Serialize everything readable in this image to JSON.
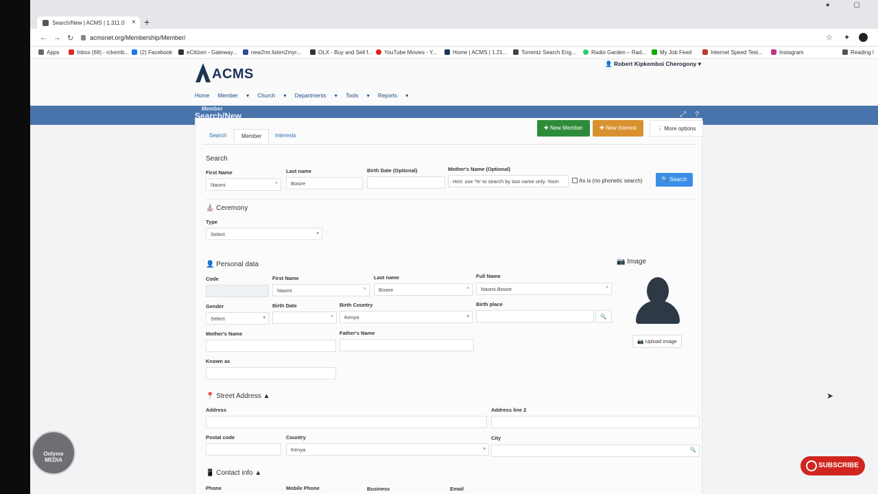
{
  "browser": {
    "tab_title": "Search/New | ACMS | 1.311.0",
    "url": "acmsnet.org/Membership/Member/",
    "bookmarks": [
      "Apps",
      "Inbox (69) - rckemb...",
      "(2) Facebook",
      "eCitizen - Gateway...",
      "new2mr.listen2myr...",
      "OLX - Buy and Sell f...",
      "YouTube Movies - Y...",
      "Home | ACMS | 1.21...",
      "Torrentz Search Eng...",
      "Radio Garden – Rad...",
      "My Job Feed",
      "Internet Speed Test...",
      "Instagram",
      "Reading l"
    ]
  },
  "app": {
    "logo": "ACMS",
    "user": "Robert Kipkemboi Cherogony",
    "menu": [
      "Home",
      "Member",
      "Church",
      "Departments",
      "Tools",
      "Reports"
    ],
    "breadcrumb_pre": "Member",
    "page_title": "Search/New"
  },
  "tabs": [
    "Search",
    "Member",
    "Interests"
  ],
  "actions": {
    "new_member": "New Member",
    "new_interest": "New Interest",
    "more_options": "More options"
  },
  "search": {
    "heading": "Search",
    "first_name_label": "First Name",
    "first_name": "Naomi",
    "last_name_label": "Last name",
    "last_name": "Bosire",
    "birth_label": "Birth Date (Optional)",
    "mother_label": "Mother's Name (Optional)",
    "mother_placeholder": "Hint: use '%' to search by last name only. %sm",
    "as_is": "As is (no phonetic search)",
    "search_button": "Search"
  },
  "ceremony": {
    "heading": "Ceremony",
    "type_label": "Type",
    "type_value": "Select"
  },
  "personal": {
    "heading": "Personal data",
    "code_label": "Code",
    "first_name_label": "First Name",
    "first_name": "Naomi",
    "last_name_label": "Last name",
    "last_name": "Bosire",
    "full_name_label": "Full Name",
    "full_name": "Naomi Bosire",
    "gender_label": "Gender",
    "gender": "Select",
    "birth_date_label": "Birth Date",
    "birth_country_label": "Birth Country",
    "birth_country": "Kenya",
    "birth_place_label": "Birth place",
    "mother_label": "Mother's Name",
    "father_label": "Father's Name",
    "known_label": "Known as",
    "image_heading": "Image",
    "upload": "Upload image"
  },
  "address": {
    "heading": "Street Address",
    "address_label": "Address",
    "address2_label": "Address line 2",
    "postal_label": "Postal code",
    "country_label": "Country",
    "country": "Kenya",
    "city_label": "City"
  },
  "contact": {
    "heading": "Contact info",
    "phone": "Phone",
    "mobile": "Mobile Phone",
    "business": "Business",
    "email": "Email"
  },
  "overlay": {
    "channel_line1": "Onlyme",
    "channel_line2": "MEDIA",
    "subscribe": "SUBSCRIBE"
  }
}
